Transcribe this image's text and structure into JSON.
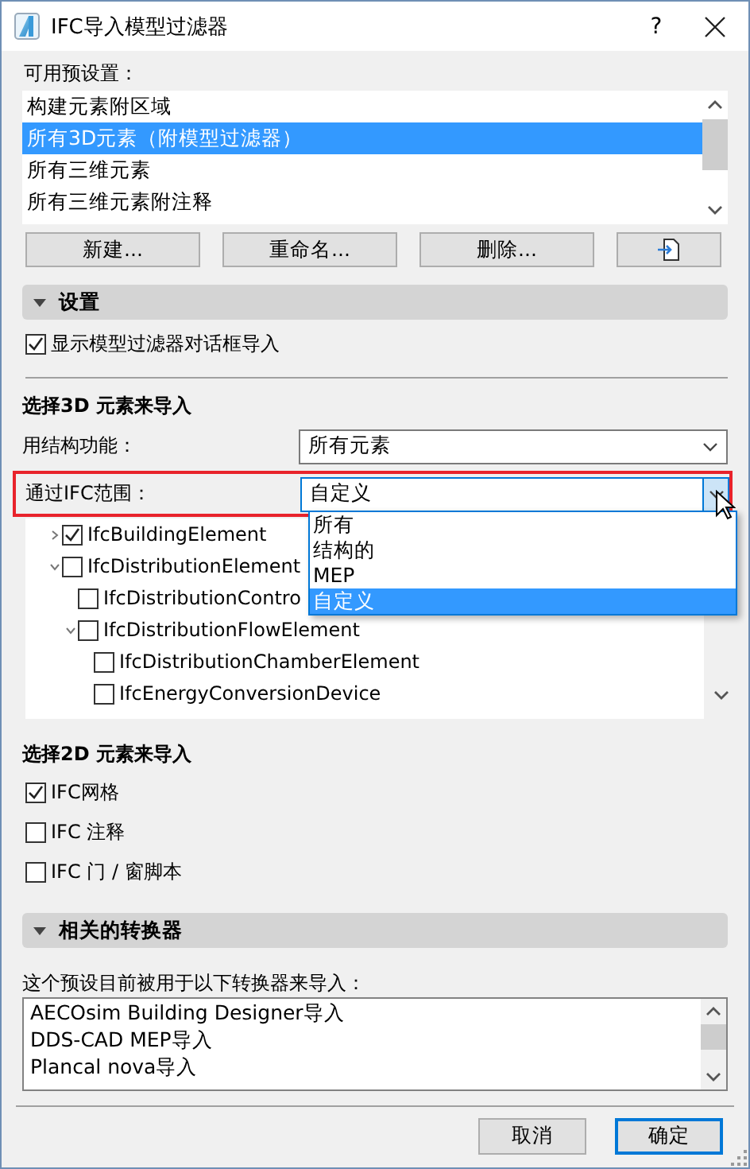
{
  "window": {
    "title": "IFC导入模型过滤器",
    "help": "?"
  },
  "presets": {
    "label": "可用预设置：",
    "items": [
      {
        "label": "构建元素附区域",
        "selected": false
      },
      {
        "label": "所有3D元素（附模型过滤器）",
        "selected": true
      },
      {
        "label": "所有三维元素",
        "selected": false
      },
      {
        "label": "所有三维元素附注释",
        "selected": false
      }
    ]
  },
  "preset_buttons": [
    {
      "kind": "text",
      "label": "新建..."
    },
    {
      "kind": "text",
      "label": "重命名..."
    },
    {
      "kind": "text",
      "label": "删除..."
    },
    {
      "kind": "icon"
    }
  ],
  "settings": {
    "title": "设置",
    "expanded": true,
    "show_dialog": {
      "label": "显示模型过滤器对话框导入",
      "checked": true
    }
  },
  "elements_3d": {
    "heading": "选择3D 元素来导入",
    "structure": {
      "label": "用结构功能：",
      "value": "所有元素"
    },
    "ifc_range": {
      "label": "通过IFC范围：",
      "value": "自定义",
      "open": true,
      "options": [
        {
          "label": "所有",
          "selected": false
        },
        {
          "label": "结构的",
          "selected": false
        },
        {
          "label": "MEP",
          "selected": false
        },
        {
          "label": "自定义",
          "selected": true
        }
      ]
    },
    "tree": [
      {
        "label": "IfcBuildingElement",
        "checked": true,
        "expanded": false
      },
      {
        "label": "IfcDistributionElement",
        "checked": false,
        "expanded": true,
        "children": [
          {
            "label": "IfcDistributionContro",
            "checked": false
          },
          {
            "label": "IfcDistributionFlowElement",
            "checked": false,
            "expanded": true,
            "children": [
              {
                "label": "IfcDistributionChamberElement",
                "checked": false
              },
              {
                "label": "IfcEnergyConversionDevice",
                "checked": false
              }
            ]
          }
        ]
      }
    ]
  },
  "elements_2d": {
    "heading": "选择2D 元素来导入",
    "items": [
      {
        "label": "IFC网格",
        "checked": true
      },
      {
        "label": "IFC 注释",
        "checked": false
      },
      {
        "label": "IFC 门 / 窗脚本",
        "checked": false
      }
    ]
  },
  "translators": {
    "title": "相关的转换器",
    "expanded": true,
    "note": "这个预设目前被用于以下转换器来导入：",
    "items": [
      "AECOsim Building Designer导入",
      "DDS-CAD MEP导入",
      "Plancal nova导入"
    ]
  },
  "buttons": [
    {
      "label": "取消",
      "default": false
    },
    {
      "label": "确定",
      "default": true
    }
  ]
}
